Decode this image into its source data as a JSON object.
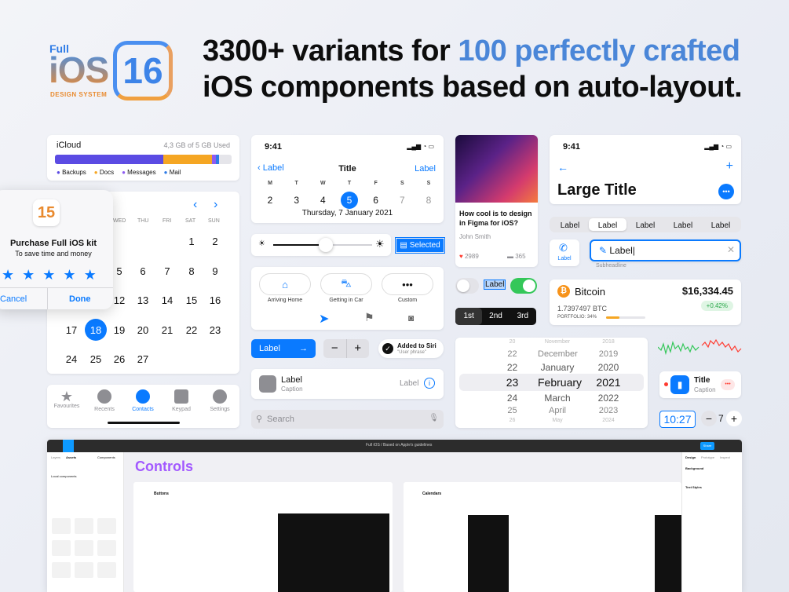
{
  "logo": {
    "full": "Full",
    "ios": "iOS",
    "num": "16",
    "ds": "DESIGN SYSTEM"
  },
  "headline": {
    "l1a": "3300+ variants for ",
    "l1b": "100 perfectly crafted",
    "l2": "iOS components based on auto-layout."
  },
  "icloud": {
    "title": "iCloud",
    "usage": "4,3 GB of 5 GB Used",
    "legend": [
      "Backups",
      "Docs",
      "Messages",
      "Mail"
    ],
    "colors": [
      "#5b4be3",
      "#f5a623",
      "#8e5cf0",
      "#2e7be6"
    ]
  },
  "purchase": {
    "badge": "15",
    "title": "Purchase Full iOS kit",
    "subtitle": "To save time and money",
    "cancel": "Cancel",
    "done": "Done"
  },
  "month": {
    "days": [
      "WED",
      "THU",
      "FRI",
      "SAT",
      "SUN"
    ],
    "rows": [
      [
        "",
        "",
        "",
        "1",
        "2"
      ],
      [
        "5",
        "6",
        "7",
        "8",
        "9"
      ],
      [
        "12",
        "13",
        "14",
        "15",
        "16"
      ],
      [
        "17",
        "18",
        "19",
        "20",
        "21",
        "22",
        "23"
      ],
      [
        "24",
        "25",
        "26",
        "27"
      ]
    ],
    "selected": "18"
  },
  "tabs": [
    "Favourites",
    "Recents",
    "Contacts",
    "Keypad",
    "Settings"
  ],
  "cal": {
    "time": "9:41",
    "back": "Label",
    "title": "Title",
    "action": "Label",
    "wd": [
      "M",
      "T",
      "W",
      "T",
      "F",
      "S",
      "S"
    ],
    "dates": [
      "2",
      "3",
      "4",
      "5",
      "6",
      "7",
      "8"
    ],
    "sel": "5",
    "caption": "Thursday, 7 January 2021"
  },
  "selected_label": "Selected",
  "chips": {
    "items": [
      "Arriving Home",
      "Getting in Car",
      "Custom"
    ]
  },
  "buttons": {
    "label": "Label",
    "siri": "Added to Siri",
    "siri_sub": "\"User phrase\"",
    "minus": "−",
    "plus": "+"
  },
  "row": {
    "title": "Label",
    "caption": "Caption",
    "value": "Label"
  },
  "search": {
    "placeholder": "Search"
  },
  "article": {
    "title": "How cool is to design in Figma for iOS?",
    "author": "John Smith",
    "likes": "2989",
    "comments": "365"
  },
  "toggle_label": "Label",
  "seg3": [
    "1st",
    "2nd",
    "3rd"
  ],
  "picker": {
    "rows": [
      [
        "20",
        "November",
        "2018"
      ],
      [
        "22",
        "December",
        "2019"
      ],
      [
        "22",
        "January",
        "2020"
      ],
      [
        "23",
        "February",
        "2021"
      ],
      [
        "24",
        "March",
        "2022"
      ],
      [
        "25",
        "April",
        "2023"
      ],
      [
        "26",
        "May",
        "2024"
      ]
    ]
  },
  "large": {
    "time": "9:41",
    "title": "Large Title",
    "plus": "+",
    "seg": [
      "Label",
      "Label",
      "Label",
      "Label",
      "Label"
    ],
    "field": "Label",
    "subheadline": "Subheadline",
    "side": "Label"
  },
  "btc": {
    "name": "Bitcoin",
    "price": "$16,334.45",
    "amount": "1.7397497 BTC",
    "change": "+0.42%",
    "portfolio": "PORTFOLIO: 34%"
  },
  "widget": {
    "title": "Title",
    "caption": "Caption"
  },
  "timer": {
    "value": "10:27",
    "step": "7"
  },
  "figma": {
    "section": "Controls",
    "buttons": "Buttons",
    "calendars": "Calendars",
    "file": "Full iOS",
    "page": "Based on Apple's guidelines",
    "share": "Share",
    "design": "Design",
    "prototype": "Prototype",
    "inspect": "Inspect",
    "background": "Background",
    "text_styles": "Text Styles",
    "layers": "Layers",
    "assets": "Assets",
    "components": "Components",
    "local": "Local components"
  }
}
